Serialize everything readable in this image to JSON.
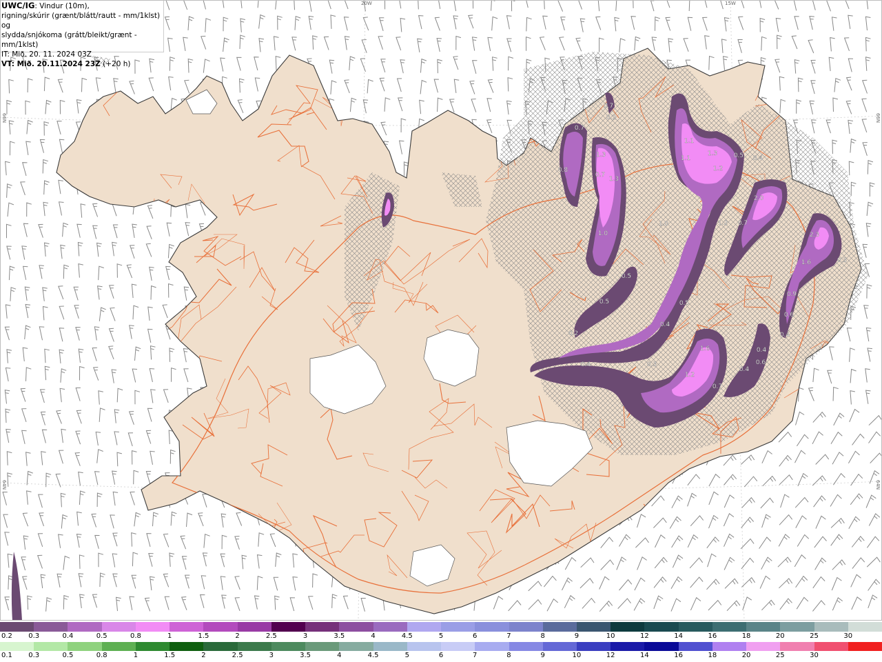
{
  "info": {
    "line1_bold": "UWC/IG",
    "line1_rest": ": Vindur (10m),",
    "line2": "rigning/skúrir (grænt/blátt/rautt - mm/1klst) og",
    "line3": "slydda/snjókoma (grátt/bleikt/grænt - mm/1klst)",
    "line4": "IT: Mið. 20. 11. 2024 03Z",
    "line5_bold": "VT: Mið. 20.11.2024 23Z",
    "line5_rest": " (+20 h)"
  },
  "grid_labels": {
    "lon_20w": "20W",
    "lon_15w": "15W",
    "lat_66n_left": "66N",
    "lat_66n_right": "66N",
    "lat_64n_left": "64N",
    "lat_64n_right": "64N"
  },
  "colors": {
    "land": "#f0dfcc",
    "coast": "#3a3a3a",
    "roads": "#e8703a",
    "glacier": "#ffffff",
    "wind_barb": "#888888",
    "hatch": "#8a8a8a"
  },
  "precip_labels": [
    {
      "v": "0.7"
    },
    {
      "v": "0.8"
    },
    {
      "v": "1.3"
    },
    {
      "v": "0.7"
    },
    {
      "v": "1.3"
    },
    {
      "v": "1.0"
    },
    {
      "v": "0.5"
    },
    {
      "v": "0.5"
    },
    {
      "v": "0.2"
    },
    {
      "v": "1.1"
    },
    {
      "v": "1.1"
    },
    {
      "v": "1.3"
    },
    {
      "v": "1.2"
    },
    {
      "v": "0.5"
    },
    {
      "v": "2.0"
    },
    {
      "v": "1.2"
    },
    {
      "v": "0.7"
    },
    {
      "v": "0.7"
    },
    {
      "v": "0.5"
    },
    {
      "v": "0.4"
    },
    {
      "v": "0.3"
    },
    {
      "v": "0.4"
    },
    {
      "v": "1.6"
    },
    {
      "v": "1.2"
    },
    {
      "v": "0.7"
    },
    {
      "v": "0.4"
    },
    {
      "v": "0.4"
    },
    {
      "v": "0.6"
    },
    {
      "v": "2.3"
    },
    {
      "v": "1.6"
    },
    {
      "v": "0.3"
    },
    {
      "v": "0.9"
    },
    {
      "v": "0.6"
    },
    {
      "v": "0.4"
    },
    {
      "v": "1.0"
    },
    {
      "v": "0.2"
    },
    {
      "v": "0.4"
    }
  ],
  "legend_snow": {
    "colors": [
      "#6b4a72",
      "#8a5a98",
      "#b06ac2",
      "#d987e8",
      "#f28cf5",
      "#ce63d6",
      "#b34bbd",
      "#993aa5",
      "#52004f",
      "#76307a",
      "#8d4fa0",
      "#9a6bbf",
      "#b0a8f0",
      "#9a9ee6",
      "#8a90dc",
      "#7d83cc",
      "#5a6b9c",
      "#3a5670",
      "#0e3a3e",
      "#1a4a50",
      "#285a5e",
      "#3d6e72",
      "#5a8488",
      "#7d9ea0",
      "#a9bcbc",
      "#d2ddd8"
    ],
    "labels": [
      "0.2",
      "0.3",
      "0.4",
      "0.5",
      "0.8",
      "1",
      "1.5",
      "2",
      "2.5",
      "3",
      "3.5",
      "4",
      "4.5",
      "5",
      "6",
      "7",
      "8",
      "9",
      "10",
      "12",
      "14",
      "16",
      "18",
      "20",
      "25",
      "30"
    ]
  },
  "legend_rain": {
    "colors": [
      "#d7f5cf",
      "#b3e8a6",
      "#8fd27e",
      "#5eb052",
      "#2e8a30",
      "#0f5f0f",
      "#2a6a3a",
      "#3c7a4c",
      "#4d8a5e",
      "#6a9a7a",
      "#86aca0",
      "#9ab8c8",
      "#b8c4ee",
      "#c8ccf6",
      "#a8acf0",
      "#8688e4",
      "#6468d6",
      "#3a3ec0",
      "#1a1aa8",
      "#0a0a98",
      "#5050d0",
      "#b080f0",
      "#f0a0f0",
      "#f080b0",
      "#f05070",
      "#f02020"
    ],
    "labels": [
      "0.1",
      "0.3",
      "0.5",
      "0.8",
      "1",
      "1.5",
      "2",
      "2.5",
      "3",
      "3.5",
      "4",
      "4.5",
      "5",
      "6",
      "7",
      "8",
      "9",
      "10",
      "12",
      "14",
      "16",
      "18",
      "20",
      "25",
      "30"
    ]
  }
}
